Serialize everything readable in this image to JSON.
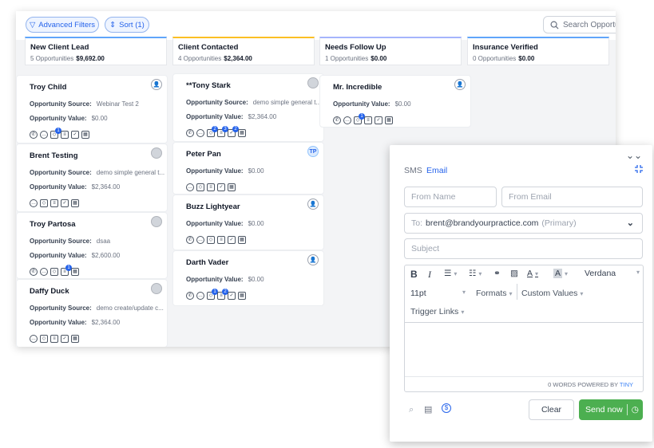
{
  "toolbar": {
    "advanced_filters_label": "Advanced Filters",
    "sort_label": "Sort (1)",
    "search_placeholder": "Search Opportu"
  },
  "columns": [
    {
      "title": "New Client Lead",
      "count": "5 Opportunities",
      "amount": "$9,692.00",
      "color": "#60a5fa"
    },
    {
      "title": "Client Contacted",
      "count": "4 Opportunities",
      "amount": "$2,364.00",
      "color": "#fbbf24"
    },
    {
      "title": "Needs Follow Up",
      "count": "1 Opportunities",
      "amount": "$0.00",
      "color": "#a5b4fc"
    },
    {
      "title": "Insurance Verified",
      "count": "0 Opportunities",
      "amount": "$0.00",
      "color": "#60a5fa"
    }
  ],
  "labels": {
    "source": "Opportunity Source:",
    "value": "Opportunity Value:"
  },
  "cards": [
    {
      "name": "Troy Child",
      "source": "Webinar Test 2",
      "value": "$0.00",
      "avatar": "user-icon"
    },
    {
      "name": "Brent Testing",
      "source": "demo simple general t...",
      "value": "$2,364.00",
      "avatar": "photo"
    },
    {
      "name": "Troy Partosa",
      "source": "dsaa",
      "value": "$2,600.00",
      "avatar": "photo"
    },
    {
      "name": "Daffy Duck",
      "source": "demo create/update c...",
      "value": "$2,364.00",
      "avatar": "photo"
    },
    {
      "name": "**Tony Stark",
      "source": "demo simple general t...",
      "value": "$2,364.00",
      "avatar": "photo"
    },
    {
      "name": "Peter Pan",
      "value": "$0.00",
      "avatar": "TP"
    },
    {
      "name": "Buzz Lightyear",
      "value": "$0.00",
      "avatar": "user-icon"
    },
    {
      "name": "Darth Vader",
      "value": "$0.00",
      "avatar": "user-icon"
    },
    {
      "name": "Mr. Incredible",
      "value": "$0.00",
      "avatar": "user-icon"
    }
  ],
  "badges": {
    "one": "1",
    "two": "2",
    "three": "3"
  },
  "panel": {
    "tab_sms": "SMS",
    "tab_email": "Email",
    "from_name_placeholder": "From Name",
    "from_email_placeholder": "From Email",
    "to_label": "To:",
    "to_value": "brent@brandyourpractice.com",
    "to_tag": "(Primary)",
    "subject_placeholder": "Subject",
    "font_name": "Verdana",
    "font_size": "11pt",
    "formats": "Formats",
    "custom_values": "Custom Values",
    "trigger_links": "Trigger Links",
    "word_count": "0 WORDS POWERED BY",
    "tiny": "TINY",
    "clear_label": "Clear",
    "send_label": "Send now"
  },
  "accent": "#2563eb",
  "send_color": "#4caf50"
}
